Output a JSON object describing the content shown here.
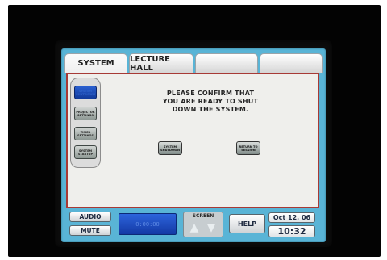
{
  "tabs": [
    {
      "label": "SYSTEM",
      "active": true
    },
    {
      "label": "LECTURE HALL",
      "active": false
    },
    {
      "label": "",
      "active": false
    },
    {
      "label": "",
      "active": false
    }
  ],
  "side_nav": {
    "items": [
      {
        "label": "SYSTEM SHUTDOWN",
        "active": true
      },
      {
        "label": "PROJECTOR SETTINGS",
        "active": false
      },
      {
        "label": "TIMER SETTINGS",
        "active": false
      },
      {
        "label": "SYSTEM STARTUP",
        "active": false
      }
    ]
  },
  "dialog": {
    "message": "PLEASE CONFIRM THAT YOU ARE READY TO SHUT DOWN THE SYSTEM.",
    "shutdown_label": "SYSTEM SHUTDOWN",
    "return_label": "RETURN TO SESSION"
  },
  "bottom_bar": {
    "audio_label": "AUDIO",
    "mute_label": "MUTE",
    "timer_value": "0:00:00",
    "screen_label": "SCREEN",
    "up_icon": "arrow-up-icon",
    "down_icon": "arrow-down-icon",
    "help_label": "HELP",
    "date": "Oct 12, 06",
    "time": "10:32"
  },
  "colors": {
    "screen_bg": "#59b4d6",
    "panel_border": "#a73a36",
    "timer_bg": "#2c64dc"
  }
}
